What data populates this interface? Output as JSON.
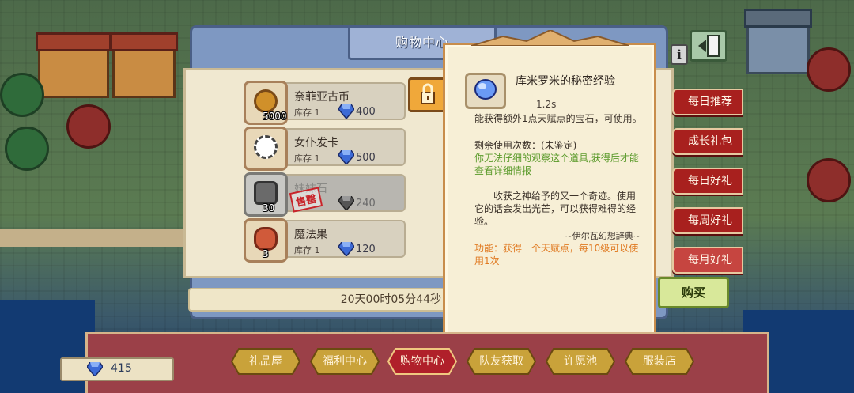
{
  "shop": {
    "title": "购物中心",
    "countdown": "20天00时05分44秒",
    "items": [
      {
        "name": "奈菲亚古币",
        "stock": "库存 1",
        "price": "400",
        "qty": "5000",
        "sold": false
      },
      {
        "name": "女仆发卡",
        "stock": "库存 1",
        "price": "500",
        "qty": "",
        "sold": false
      },
      {
        "name": "妹妹石",
        "stock": "",
        "price": "240",
        "qty": "30",
        "sold": true,
        "sold_label": "售罄"
      },
      {
        "name": "魔法果",
        "stock": "库存 1",
        "price": "120",
        "qty": "3",
        "sold": false
      }
    ]
  },
  "tooltip": {
    "title": "库米罗米的秘密经验",
    "time": "1.2s",
    "desc": "能获得额外1点天赋点的宝石，可使用。",
    "uses": "剩余使用次数：(未鉴定)",
    "hint": "你无法仔细的观察这个道具,获得后才能查看详细情报",
    "lore": "收获之神给予的又一个奇迹。使用它的话会发出光芒，可以获得难得的经验。",
    "source": "~伊尔瓦幻想辞典~",
    "function": "功能：获得一个天赋点，每10级可以使用1次"
  },
  "side_tabs": [
    "每日推荐",
    "成长礼包",
    "每日好礼",
    "每周好礼",
    "每月好礼"
  ],
  "buy_label": "购买",
  "info_label": "i",
  "nav": [
    "礼品屋",
    "福利中心",
    "购物中心",
    "队友获取",
    "许愿池",
    "服装店"
  ],
  "nav_active": "购物中心",
  "currency": {
    "amount": "415",
    "icon": "diamond-icon"
  },
  "colors": {
    "gem": "#3c6ad6",
    "tab_red": "#a8201e",
    "scroll_border": "#c88d4c"
  }
}
